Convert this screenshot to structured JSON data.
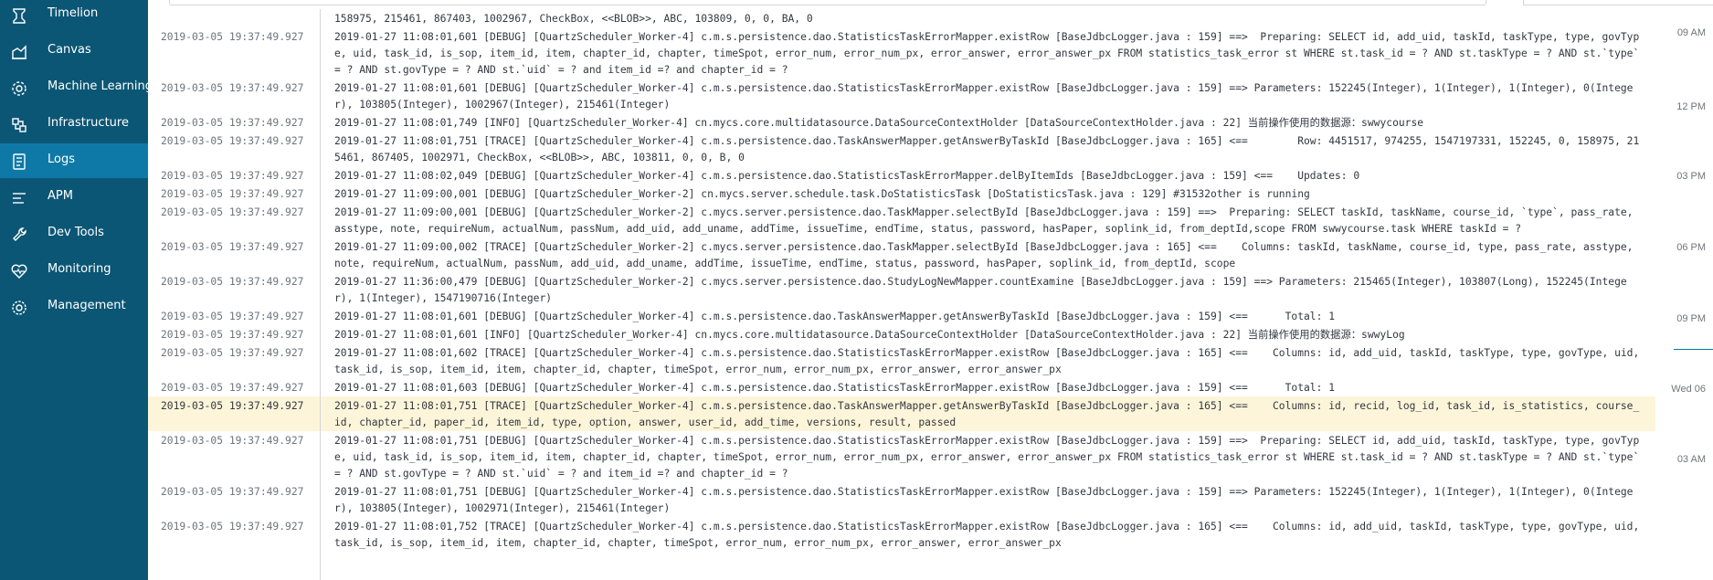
{
  "sidebar": {
    "items": [
      {
        "label": "Timelion",
        "icon": "timelion-icon"
      },
      {
        "label": "Canvas",
        "icon": "canvas-icon"
      },
      {
        "label": "Machine Learning",
        "icon": "machine-learning-icon"
      },
      {
        "label": "Infrastructure",
        "icon": "infrastructure-icon"
      },
      {
        "label": "Logs",
        "icon": "logs-icon",
        "active": true
      },
      {
        "label": "APM",
        "icon": "apm-icon"
      },
      {
        "label": "Dev Tools",
        "icon": "dev-tools-icon"
      },
      {
        "label": "Monitoring",
        "icon": "monitoring-icon"
      },
      {
        "label": "Management",
        "icon": "management-icon"
      }
    ]
  },
  "log": {
    "rows": [
      {
        "ts": "",
        "msg": "158975, 215461, 867403, 1002967, CheckBox, <<BLOB>>, ABC, 103809, 0, 0, BA, 0"
      },
      {
        "ts": "2019-03-05 19:37:49.927",
        "msg": "2019-01-27 11:08:01,601 [DEBUG] [QuartzScheduler_Worker-4] c.m.s.persistence.dao.StatisticsTaskErrorMapper.existRow [BaseJdbcLogger.java : 159] ==>  Preparing: SELECT id, add_uid, taskId, taskType, type, govType, uid, task_id, is_sop, item_id, item, chapter_id, chapter, timeSpot, error_num, error_num_px, error_answer, error_answer_px FROM statistics_task_error st WHERE st.task_id = ? AND st.taskType = ? AND st.`type` = ? AND st.govType = ? AND st.`uid` = ? and item_id =? and chapter_id = ?"
      },
      {
        "ts": "2019-03-05 19:37:49.927",
        "msg": "2019-01-27 11:08:01,601 [DEBUG] [QuartzScheduler_Worker-4] c.m.s.persistence.dao.StatisticsTaskErrorMapper.existRow [BaseJdbcLogger.java : 159] ==> Parameters: 152245(Integer), 1(Integer), 1(Integer), 0(Integer), 103805(Integer), 1002967(Integer), 215461(Integer)"
      },
      {
        "ts": "2019-03-05 19:37:49.927",
        "msg": "2019-01-27 11:08:01,749 [INFO] [QuartzScheduler_Worker-4] cn.mycs.core.multidatasource.DataSourceContextHolder [DataSourceContextHolder.java : 22] 当前操作使用的数据源：swwycourse"
      },
      {
        "ts": "2019-03-05 19:37:49.927",
        "msg": "2019-01-27 11:08:01,751 [TRACE] [QuartzScheduler_Worker-4] c.m.s.persistence.dao.TaskAnswerMapper.getAnswerByTaskId [BaseJdbcLogger.java : 165] <==        Row: 4451517, 974255, 1547197331, 152245, 0, 158975, 215461, 867405, 1002971, CheckBox, <<BLOB>>, ABC, 103811, 0, 0, B, 0"
      },
      {
        "ts": "2019-03-05 19:37:49.927",
        "msg": "2019-01-27 11:08:02,049 [DEBUG] [QuartzScheduler_Worker-4] c.m.s.persistence.dao.StatisticsTaskErrorMapper.delByItemIds [BaseJdbcLogger.java : 159] <==    Updates: 0"
      },
      {
        "ts": "2019-03-05 19:37:49.927",
        "msg": "2019-01-27 11:09:00,001 [DEBUG] [QuartzScheduler_Worker-2] cn.mycs.server.schedule.task.DoStatisticsTask [DoStatisticsTask.java : 129] #31532other is running"
      },
      {
        "ts": "2019-03-05 19:37:49.927",
        "msg": "2019-01-27 11:09:00,001 [DEBUG] [QuartzScheduler_Worker-2] c.mycs.server.persistence.dao.TaskMapper.selectById [BaseJdbcLogger.java : 159] ==>  Preparing: SELECT taskId, taskName, course_id, `type`, pass_rate, asstype, note, requireNum, actualNum, passNum, add_uid, add_uname, addTime, issueTime, endTime, status, password, hasPaper, soplink_id, from_deptId,scope FROM swwycourse.task WHERE taskId = ?"
      },
      {
        "ts": "2019-03-05 19:37:49.927",
        "msg": "2019-01-27 11:09:00,002 [TRACE] [QuartzScheduler_Worker-2] c.mycs.server.persistence.dao.TaskMapper.selectById [BaseJdbcLogger.java : 165] <==    Columns: taskId, taskName, course_id, type, pass_rate, asstype, note, requireNum, actualNum, passNum, add_uid, add_uname, addTime, issueTime, endTime, status, password, hasPaper, soplink_id, from_deptId, scope"
      },
      {
        "ts": "2019-03-05 19:37:49.927",
        "msg": "2019-01-27 11:36:00,479 [DEBUG] [QuartzScheduler_Worker-2] c.mycs.server.persistence.dao.StudyLogNewMapper.countExamine [BaseJdbcLogger.java : 159] ==> Parameters: 215465(Integer), 103807(Long), 152245(Integer), 1(Integer), 1547190716(Integer)"
      },
      {
        "ts": "2019-03-05 19:37:49.927",
        "msg": "2019-01-27 11:08:01,601 [DEBUG] [QuartzScheduler_Worker-4] c.m.s.persistence.dao.TaskAnswerMapper.getAnswerByTaskId [BaseJdbcLogger.java : 159] <==      Total: 1"
      },
      {
        "ts": "2019-03-05 19:37:49.927",
        "msg": "2019-01-27 11:08:01,601 [INFO] [QuartzScheduler_Worker-4] cn.mycs.core.multidatasource.DataSourceContextHolder [DataSourceContextHolder.java : 22] 当前操作使用的数据源：swwyLog"
      },
      {
        "ts": "2019-03-05 19:37:49.927",
        "msg": "2019-01-27 11:08:01,602 [TRACE] [QuartzScheduler_Worker-4] c.m.s.persistence.dao.StatisticsTaskErrorMapper.existRow [BaseJdbcLogger.java : 165] <==    Columns: id, add_uid, taskId, taskType, type, govType, uid, task_id, is_sop, item_id, item, chapter_id, chapter, timeSpot, error_num, error_num_px, error_answer, error_answer_px"
      },
      {
        "ts": "2019-03-05 19:37:49.927",
        "msg": "2019-01-27 11:08:01,603 [DEBUG] [QuartzScheduler_Worker-4] c.m.s.persistence.dao.StatisticsTaskErrorMapper.existRow [BaseJdbcLogger.java : 159] <==      Total: 1"
      },
      {
        "ts": "2019-03-05 19:37:49.927",
        "msg": "2019-01-27 11:08:01,751 [TRACE] [QuartzScheduler_Worker-4] c.m.s.persistence.dao.TaskAnswerMapper.getAnswerByTaskId [BaseJdbcLogger.java : 165] <==    Columns: id, recid, log_id, task_id, is_statistics, course_id, chapter_id, paper_id, item_id, type, option, answer, user_id, add_time, versions, result, passed",
        "highlight": true
      },
      {
        "ts": "2019-03-05 19:37:49.927",
        "msg": "2019-01-27 11:08:01,751 [DEBUG] [QuartzScheduler_Worker-4] c.m.s.persistence.dao.StatisticsTaskErrorMapper.existRow [BaseJdbcLogger.java : 159] ==>  Preparing: SELECT id, add_uid, taskId, taskType, type, govType, uid, task_id, is_sop, item_id, item, chapter_id, chapter, timeSpot, error_num, error_num_px, error_answer, error_answer_px FROM statistics_task_error st WHERE st.task_id = ? AND st.taskType = ? AND st.`type` = ? AND st.govType = ? AND st.`uid` = ? and item_id =? and chapter_id = ?"
      },
      {
        "ts": "2019-03-05 19:37:49.927",
        "msg": "2019-01-27 11:08:01,751 [DEBUG] [QuartzScheduler_Worker-4] c.m.s.persistence.dao.StatisticsTaskErrorMapper.existRow [BaseJdbcLogger.java : 159] ==> Parameters: 152245(Integer), 1(Integer), 1(Integer), 0(Integer), 103805(Integer), 1002971(Integer), 215461(Integer)"
      },
      {
        "ts": "2019-03-05 19:37:49.927",
        "msg": "2019-01-27 11:08:01,752 [TRACE] [QuartzScheduler_Worker-4] c.m.s.persistence.dao.StatisticsTaskErrorMapper.existRow [BaseJdbcLogger.java : 165] <==    Columns: id, add_uid, taskId, taskType, type, govType, uid, task_id, is_sop, item_id, item, chapter_id, chapter, timeSpot, error_num, error_num_px, error_answer, error_answer_px"
      }
    ]
  },
  "timeline": {
    "ticks": [
      "09 AM",
      "12 PM",
      "03 PM",
      "06 PM",
      "09 PM",
      "Wed 06",
      "03 AM"
    ],
    "accent": "#0079a5"
  },
  "colors": {
    "sidebar_bg": "#0c5675",
    "sidebar_active": "#0e79a6",
    "highlight_row": "#fdf5d9"
  }
}
